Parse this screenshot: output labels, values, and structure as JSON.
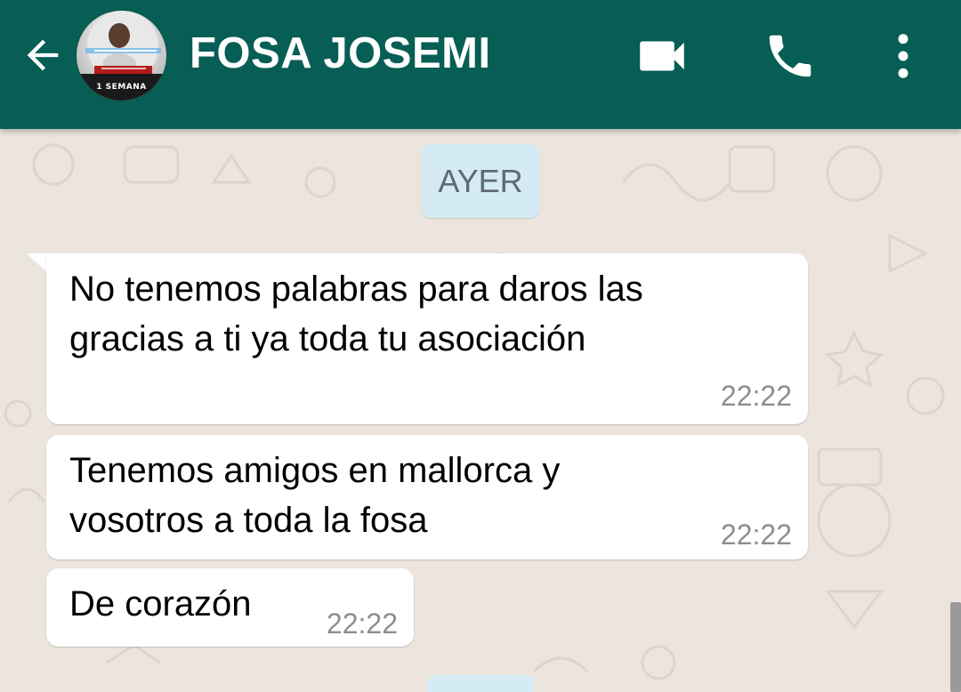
{
  "header": {
    "contact_name": "FOSA JOSEMI",
    "avatar_caption": "1 SEMANA",
    "icons": {
      "back": "arrow-back-icon",
      "video": "video-camera-icon",
      "call": "phone-icon",
      "menu": "more-vert-icon"
    },
    "accent_color": "#075e54"
  },
  "chat": {
    "date_separator": "AYER",
    "messages": [
      {
        "text": "No tenemos palabras para daros las\ngracias a ti ya toda tu asociación",
        "time": "22:22"
      },
      {
        "text": "Tenemos amigos en mallorca y\nvosotros a toda la fosa",
        "time": "22:22"
      },
      {
        "text": "De corazón",
        "time": "22:22"
      }
    ],
    "bubble_color": "#ffffff",
    "date_chip_color": "#d4eaf4",
    "background_color": "#ece5dd"
  }
}
